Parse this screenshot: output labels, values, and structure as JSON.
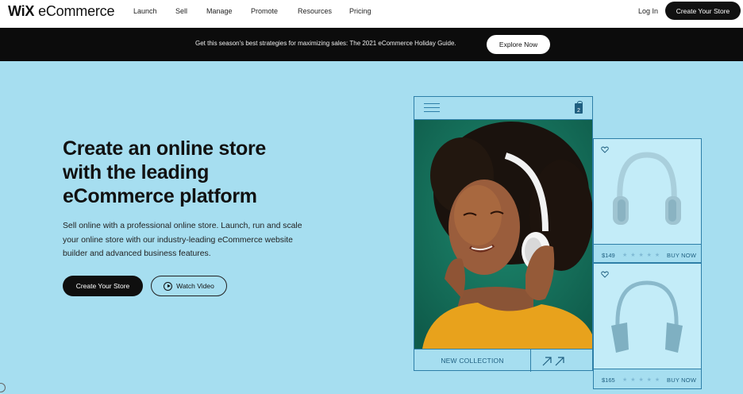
{
  "nav": {
    "logo_brand": "WiX",
    "logo_product": "eCommerce",
    "items": [
      {
        "label": "Launch"
      },
      {
        "label": "Sell"
      },
      {
        "label": "Manage"
      },
      {
        "label": "Promote"
      },
      {
        "label": "Resources"
      },
      {
        "label": "Pricing"
      }
    ],
    "login_label": "Log In",
    "cta_label": "Create Your Store"
  },
  "promo": {
    "text": "Get this season's best strategies for maximizing sales: The 2021 eCommerce Holiday Guide.",
    "button_label": "Explore Now"
  },
  "hero": {
    "headline_line1": "Create an online store",
    "headline_line2": "with the leading",
    "headline_line3": "eCommerce platform",
    "subtext": "Sell online with a professional online store. Launch, run and scale your online store with our industry-leading eCommerce website builder and advanced business features.",
    "primary_cta": "Create Your Store",
    "video_cta": "Watch Video"
  },
  "mockup": {
    "cart_count": "2",
    "collection_label": "NEW COLLECTION",
    "products": [
      {
        "price": "$149",
        "stars": "★ ★ ★ ★ ★",
        "buy_label": "BUY NOW"
      },
      {
        "price": "$165",
        "stars": "★ ★ ★ ★ ★",
        "buy_label": "BUY NOW"
      }
    ]
  },
  "colors": {
    "background": "#a6def0",
    "accent": "#2e7fa8",
    "dark": "#0c0c0c"
  }
}
